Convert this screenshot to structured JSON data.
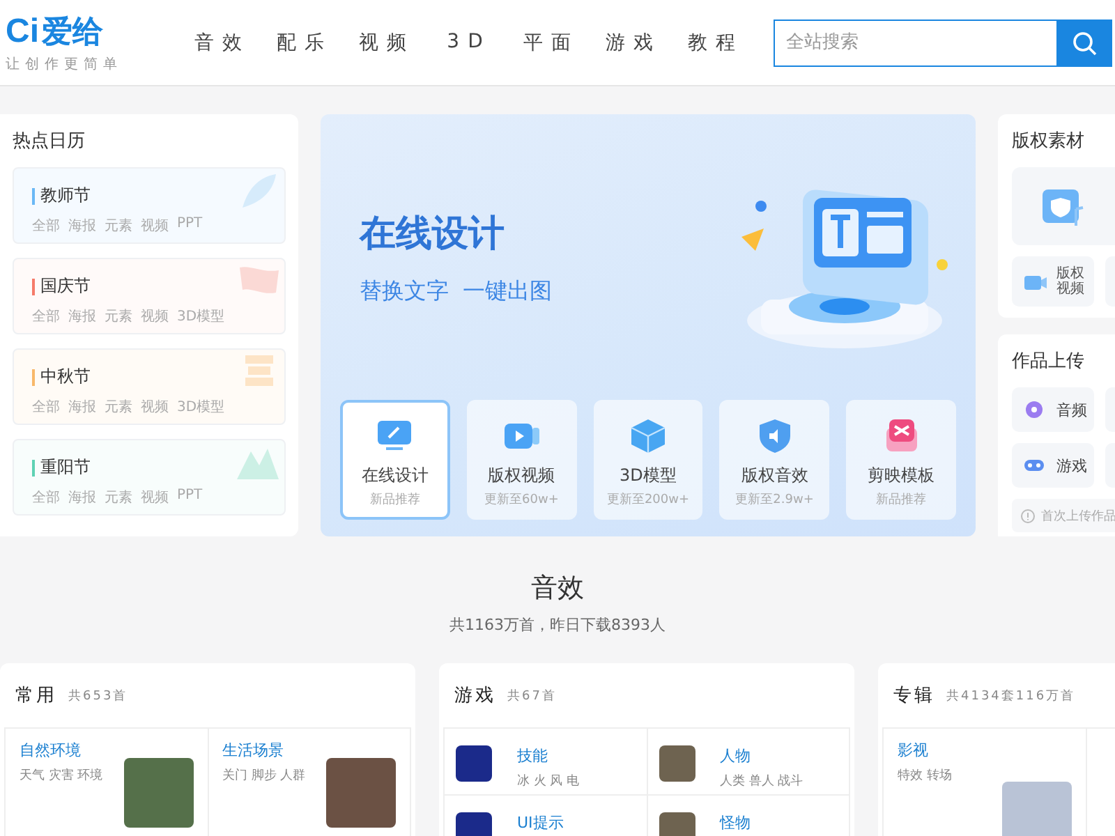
{
  "header": {
    "logo_mark": "Ci",
    "logo": "爱给",
    "slogan": "让创作更简单",
    "nav": [
      {
        "label": "音效"
      },
      {
        "label": "配乐"
      },
      {
        "label": "视频"
      },
      {
        "label": "3D"
      },
      {
        "label": "平面"
      },
      {
        "label": "游戏"
      },
      {
        "label": "教程"
      }
    ],
    "search": {
      "placeholder": "全站搜索"
    }
  },
  "calendar": {
    "title": "热点日历",
    "items": [
      {
        "name": "教师节",
        "color": "#6ab8f5",
        "tags": [
          "全部",
          "海报",
          "元素",
          "视频",
          "PPT"
        ]
      },
      {
        "name": "国庆节",
        "color": "#f57b6a",
        "tags": [
          "全部",
          "海报",
          "元素",
          "视频",
          "3D模型"
        ]
      },
      {
        "name": "中秋节",
        "color": "#f8b86a",
        "tags": [
          "全部",
          "海报",
          "元素",
          "视频",
          "3D模型"
        ]
      },
      {
        "name": "重阳节",
        "color": "#5fd2b4",
        "tags": [
          "全部",
          "海报",
          "元素",
          "视频",
          "PPT"
        ]
      }
    ]
  },
  "banner": {
    "title": "在线设计",
    "subtitle": "替换文字  一键出图",
    "tiles": [
      {
        "label": "在线设计",
        "note": "新品推荐",
        "selected": true
      },
      {
        "label": "版权视频",
        "note": "更新至60w+",
        "selected": false
      },
      {
        "label": "3D模型",
        "note": "更新至200w+",
        "selected": false
      },
      {
        "label": "版权音效",
        "note": "更新至2.9w+",
        "selected": false
      },
      {
        "label": "剪映模板",
        "note": "新品推荐",
        "selected": false
      }
    ]
  },
  "copyright": {
    "title": "版权素材",
    "items": [
      {
        "label": "版权视频"
      }
    ]
  },
  "upload": {
    "title": "作品上传",
    "items": [
      {
        "label": "音频"
      },
      {
        "label": "游戏"
      }
    ],
    "notice": "首次上传作品"
  },
  "section": {
    "title": "音效",
    "summary": "共1163万首，昨日下载8393人"
  },
  "categories": [
    {
      "title": "常用",
      "count": "共653首",
      "kind": "photo",
      "items": [
        {
          "name": "自然环境",
          "tags": "天气 灾害 环境"
        },
        {
          "name": "生活场景",
          "tags": "关门 脚步 人群"
        }
      ]
    },
    {
      "title": "游戏",
      "count": "共67首",
      "kind": "icon",
      "items": [
        {
          "name": "技能",
          "tags": "冰 火 风 电"
        },
        {
          "name": "人物",
          "tags": "人类 兽人 战斗"
        },
        {
          "name": "UI提示"
        },
        {
          "name": "怪物"
        }
      ]
    },
    {
      "title": "专辑",
      "count": "共4134套116万首",
      "kind": "photo",
      "items": [
        {
          "name": "影视",
          "tags": "特效 转场"
        }
      ]
    }
  ]
}
